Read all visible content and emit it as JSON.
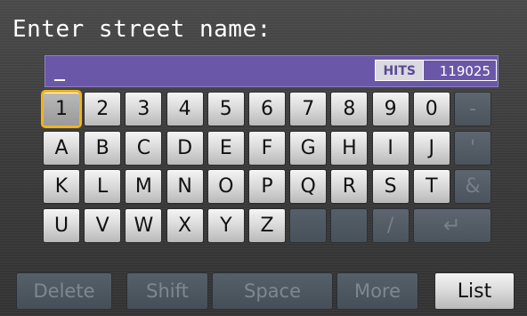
{
  "header": {
    "title": "Enter street name:"
  },
  "field": {
    "cursor": "_",
    "hits_label": "HITS",
    "hits_value": "119025"
  },
  "keyboard": {
    "rows": [
      [
        "1",
        "2",
        "3",
        "4",
        "5",
        "6",
        "7",
        "8",
        "9",
        "0",
        "-"
      ],
      [
        "A",
        "B",
        "C",
        "D",
        "E",
        "F",
        "G",
        "H",
        "I",
        "J",
        "'"
      ],
      [
        "K",
        "L",
        "M",
        "N",
        "O",
        "P",
        "Q",
        "R",
        "S",
        "T",
        "&"
      ],
      [
        "U",
        "V",
        "W",
        "X",
        "Y",
        "Z",
        "",
        "",
        "/",
        "↵"
      ]
    ],
    "selected": "1",
    "disabled": [
      "-",
      "'",
      "&",
      "/",
      "↵"
    ]
  },
  "buttons": {
    "delete": "Delete",
    "shift": "Shift",
    "space": "Space",
    "more": "More",
    "list": "List"
  },
  "colors": {
    "field": "#6b57a8",
    "highlight": "#f2b21d"
  }
}
